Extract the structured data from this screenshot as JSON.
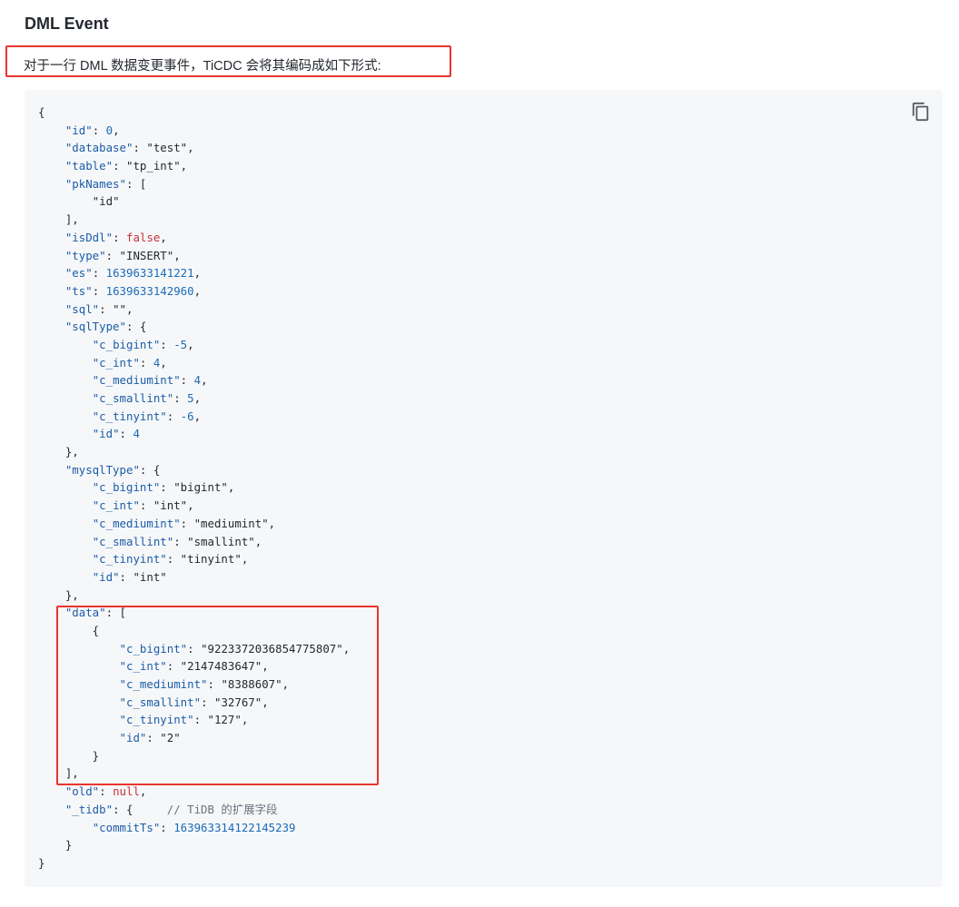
{
  "heading": "DML Event",
  "intro": "对于一行 DML 数据变更事件，TiCDC 会将其编码成如下形式:",
  "copy_icon": "copy-icon",
  "colors": {
    "highlight_border": "#e8352f",
    "code_background": "#f6f7f9",
    "json_key": "#1b5da8",
    "json_number": "#1b6cb8",
    "json_keyword": "#c8303a",
    "comment": "#6a737d"
  },
  "code": {
    "lines": [
      [
        {
          "t": "p",
          "v": "{"
        }
      ],
      [
        {
          "t": "p",
          "v": "    "
        },
        {
          "t": "k",
          "v": "\"id\""
        },
        {
          "t": "p",
          "v": ": "
        },
        {
          "t": "n",
          "v": "0"
        },
        {
          "t": "p",
          "v": ","
        }
      ],
      [
        {
          "t": "p",
          "v": "    "
        },
        {
          "t": "k",
          "v": "\"database\""
        },
        {
          "t": "p",
          "v": ": "
        },
        {
          "t": "s",
          "v": "\"test\""
        },
        {
          "t": "p",
          "v": ","
        }
      ],
      [
        {
          "t": "p",
          "v": "    "
        },
        {
          "t": "k",
          "v": "\"table\""
        },
        {
          "t": "p",
          "v": ": "
        },
        {
          "t": "s",
          "v": "\"tp_int\""
        },
        {
          "t": "p",
          "v": ","
        }
      ],
      [
        {
          "t": "p",
          "v": "    "
        },
        {
          "t": "k",
          "v": "\"pkNames\""
        },
        {
          "t": "p",
          "v": ": ["
        }
      ],
      [
        {
          "t": "p",
          "v": "        "
        },
        {
          "t": "s",
          "v": "\"id\""
        }
      ],
      [
        {
          "t": "p",
          "v": "    ],"
        }
      ],
      [
        {
          "t": "p",
          "v": "    "
        },
        {
          "t": "k",
          "v": "\"isDdl\""
        },
        {
          "t": "p",
          "v": ": "
        },
        {
          "t": "b",
          "v": "false"
        },
        {
          "t": "p",
          "v": ","
        }
      ],
      [
        {
          "t": "p",
          "v": "    "
        },
        {
          "t": "k",
          "v": "\"type\""
        },
        {
          "t": "p",
          "v": ": "
        },
        {
          "t": "s",
          "v": "\"INSERT\""
        },
        {
          "t": "p",
          "v": ","
        }
      ],
      [
        {
          "t": "p",
          "v": "    "
        },
        {
          "t": "k",
          "v": "\"es\""
        },
        {
          "t": "p",
          "v": ": "
        },
        {
          "t": "n",
          "v": "1639633141221"
        },
        {
          "t": "p",
          "v": ","
        }
      ],
      [
        {
          "t": "p",
          "v": "    "
        },
        {
          "t": "k",
          "v": "\"ts\""
        },
        {
          "t": "p",
          "v": ": "
        },
        {
          "t": "n",
          "v": "1639633142960"
        },
        {
          "t": "p",
          "v": ","
        }
      ],
      [
        {
          "t": "p",
          "v": "    "
        },
        {
          "t": "k",
          "v": "\"sql\""
        },
        {
          "t": "p",
          "v": ": "
        },
        {
          "t": "s",
          "v": "\"\""
        },
        {
          "t": "p",
          "v": ","
        }
      ],
      [
        {
          "t": "p",
          "v": "    "
        },
        {
          "t": "k",
          "v": "\"sqlType\""
        },
        {
          "t": "p",
          "v": ": {"
        }
      ],
      [
        {
          "t": "p",
          "v": "        "
        },
        {
          "t": "k",
          "v": "\"c_bigint\""
        },
        {
          "t": "p",
          "v": ": "
        },
        {
          "t": "n",
          "v": "-5"
        },
        {
          "t": "p",
          "v": ","
        }
      ],
      [
        {
          "t": "p",
          "v": "        "
        },
        {
          "t": "k",
          "v": "\"c_int\""
        },
        {
          "t": "p",
          "v": ": "
        },
        {
          "t": "n",
          "v": "4"
        },
        {
          "t": "p",
          "v": ","
        }
      ],
      [
        {
          "t": "p",
          "v": "        "
        },
        {
          "t": "k",
          "v": "\"c_mediumint\""
        },
        {
          "t": "p",
          "v": ": "
        },
        {
          "t": "n",
          "v": "4"
        },
        {
          "t": "p",
          "v": ","
        }
      ],
      [
        {
          "t": "p",
          "v": "        "
        },
        {
          "t": "k",
          "v": "\"c_smallint\""
        },
        {
          "t": "p",
          "v": ": "
        },
        {
          "t": "n",
          "v": "5"
        },
        {
          "t": "p",
          "v": ","
        }
      ],
      [
        {
          "t": "p",
          "v": "        "
        },
        {
          "t": "k",
          "v": "\"c_tinyint\""
        },
        {
          "t": "p",
          "v": ": "
        },
        {
          "t": "n",
          "v": "-6"
        },
        {
          "t": "p",
          "v": ","
        }
      ],
      [
        {
          "t": "p",
          "v": "        "
        },
        {
          "t": "k",
          "v": "\"id\""
        },
        {
          "t": "p",
          "v": ": "
        },
        {
          "t": "n",
          "v": "4"
        }
      ],
      [
        {
          "t": "p",
          "v": "    },"
        }
      ],
      [
        {
          "t": "p",
          "v": "    "
        },
        {
          "t": "k",
          "v": "\"mysqlType\""
        },
        {
          "t": "p",
          "v": ": {"
        }
      ],
      [
        {
          "t": "p",
          "v": "        "
        },
        {
          "t": "k",
          "v": "\"c_bigint\""
        },
        {
          "t": "p",
          "v": ": "
        },
        {
          "t": "s",
          "v": "\"bigint\""
        },
        {
          "t": "p",
          "v": ","
        }
      ],
      [
        {
          "t": "p",
          "v": "        "
        },
        {
          "t": "k",
          "v": "\"c_int\""
        },
        {
          "t": "p",
          "v": ": "
        },
        {
          "t": "s",
          "v": "\"int\""
        },
        {
          "t": "p",
          "v": ","
        }
      ],
      [
        {
          "t": "p",
          "v": "        "
        },
        {
          "t": "k",
          "v": "\"c_mediumint\""
        },
        {
          "t": "p",
          "v": ": "
        },
        {
          "t": "s",
          "v": "\"mediumint\""
        },
        {
          "t": "p",
          "v": ","
        }
      ],
      [
        {
          "t": "p",
          "v": "        "
        },
        {
          "t": "k",
          "v": "\"c_smallint\""
        },
        {
          "t": "p",
          "v": ": "
        },
        {
          "t": "s",
          "v": "\"smallint\""
        },
        {
          "t": "p",
          "v": ","
        }
      ],
      [
        {
          "t": "p",
          "v": "        "
        },
        {
          "t": "k",
          "v": "\"c_tinyint\""
        },
        {
          "t": "p",
          "v": ": "
        },
        {
          "t": "s",
          "v": "\"tinyint\""
        },
        {
          "t": "p",
          "v": ","
        }
      ],
      [
        {
          "t": "p",
          "v": "        "
        },
        {
          "t": "k",
          "v": "\"id\""
        },
        {
          "t": "p",
          "v": ": "
        },
        {
          "t": "s",
          "v": "\"int\""
        }
      ],
      [
        {
          "t": "p",
          "v": "    },"
        }
      ],
      [
        {
          "t": "p",
          "v": "    "
        },
        {
          "t": "k",
          "v": "\"data\""
        },
        {
          "t": "p",
          "v": ": ["
        }
      ],
      [
        {
          "t": "p",
          "v": "        {"
        }
      ],
      [
        {
          "t": "p",
          "v": "            "
        },
        {
          "t": "k",
          "v": "\"c_bigint\""
        },
        {
          "t": "p",
          "v": ": "
        },
        {
          "t": "s",
          "v": "\"9223372036854775807\""
        },
        {
          "t": "p",
          "v": ","
        }
      ],
      [
        {
          "t": "p",
          "v": "            "
        },
        {
          "t": "k",
          "v": "\"c_int\""
        },
        {
          "t": "p",
          "v": ": "
        },
        {
          "t": "s",
          "v": "\"2147483647\""
        },
        {
          "t": "p",
          "v": ","
        }
      ],
      [
        {
          "t": "p",
          "v": "            "
        },
        {
          "t": "k",
          "v": "\"c_mediumint\""
        },
        {
          "t": "p",
          "v": ": "
        },
        {
          "t": "s",
          "v": "\"8388607\""
        },
        {
          "t": "p",
          "v": ","
        }
      ],
      [
        {
          "t": "p",
          "v": "            "
        },
        {
          "t": "k",
          "v": "\"c_smallint\""
        },
        {
          "t": "p",
          "v": ": "
        },
        {
          "t": "s",
          "v": "\"32767\""
        },
        {
          "t": "p",
          "v": ","
        }
      ],
      [
        {
          "t": "p",
          "v": "            "
        },
        {
          "t": "k",
          "v": "\"c_tinyint\""
        },
        {
          "t": "p",
          "v": ": "
        },
        {
          "t": "s",
          "v": "\"127\""
        },
        {
          "t": "p",
          "v": ","
        }
      ],
      [
        {
          "t": "p",
          "v": "            "
        },
        {
          "t": "k",
          "v": "\"id\""
        },
        {
          "t": "p",
          "v": ": "
        },
        {
          "t": "s",
          "v": "\"2\""
        }
      ],
      [
        {
          "t": "p",
          "v": "        }"
        }
      ],
      [
        {
          "t": "p",
          "v": "    ],"
        }
      ],
      [
        {
          "t": "p",
          "v": "    "
        },
        {
          "t": "k",
          "v": "\"old\""
        },
        {
          "t": "p",
          "v": ": "
        },
        {
          "t": "b",
          "v": "null"
        },
        {
          "t": "p",
          "v": ","
        }
      ],
      [
        {
          "t": "p",
          "v": "    "
        },
        {
          "t": "k",
          "v": "\"_tidb\""
        },
        {
          "t": "p",
          "v": ": {     "
        },
        {
          "t": "c",
          "v": "// TiDB 的扩展字段"
        }
      ],
      [
        {
          "t": "p",
          "v": "        "
        },
        {
          "t": "k",
          "v": "\"commitTs\""
        },
        {
          "t": "p",
          "v": ": "
        },
        {
          "t": "n",
          "v": "163963314122145239"
        }
      ],
      [
        {
          "t": "p",
          "v": "    }"
        }
      ],
      [
        {
          "t": "p",
          "v": "}"
        }
      ]
    ]
  }
}
